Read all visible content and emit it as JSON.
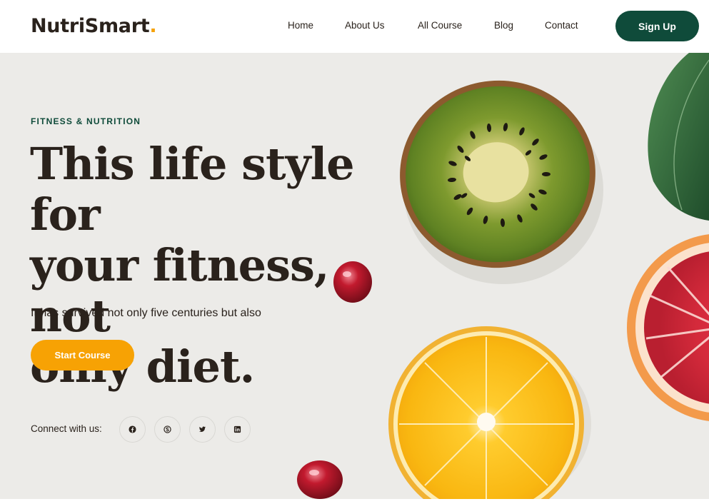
{
  "header": {
    "logo_text": "NutriSmart",
    "logo_dot": ".",
    "nav": [
      {
        "label": "Home"
      },
      {
        "label": "About Us"
      },
      {
        "label": "All Course"
      },
      {
        "label": "Blog"
      },
      {
        "label": "Contact"
      }
    ],
    "signup_label": "Sign Up"
  },
  "hero": {
    "eyebrow": "FITNESS & NUTRITION",
    "headline_lines": [
      "This life style for",
      "your fitness, not",
      "only diet."
    ],
    "subtext": "It has survived not only five centuries but also",
    "cta_label": "Start Course",
    "connect_label": "Connect with us:",
    "social_icons": [
      "facebook-icon",
      "skype-icon",
      "twitter-icon",
      "linkedin-icon"
    ]
  },
  "colors": {
    "brand_green": "#0f4b3a",
    "accent_orange": "#f7a204",
    "text_dark": "#2a221c",
    "hero_bg": "#ecebe8"
  }
}
